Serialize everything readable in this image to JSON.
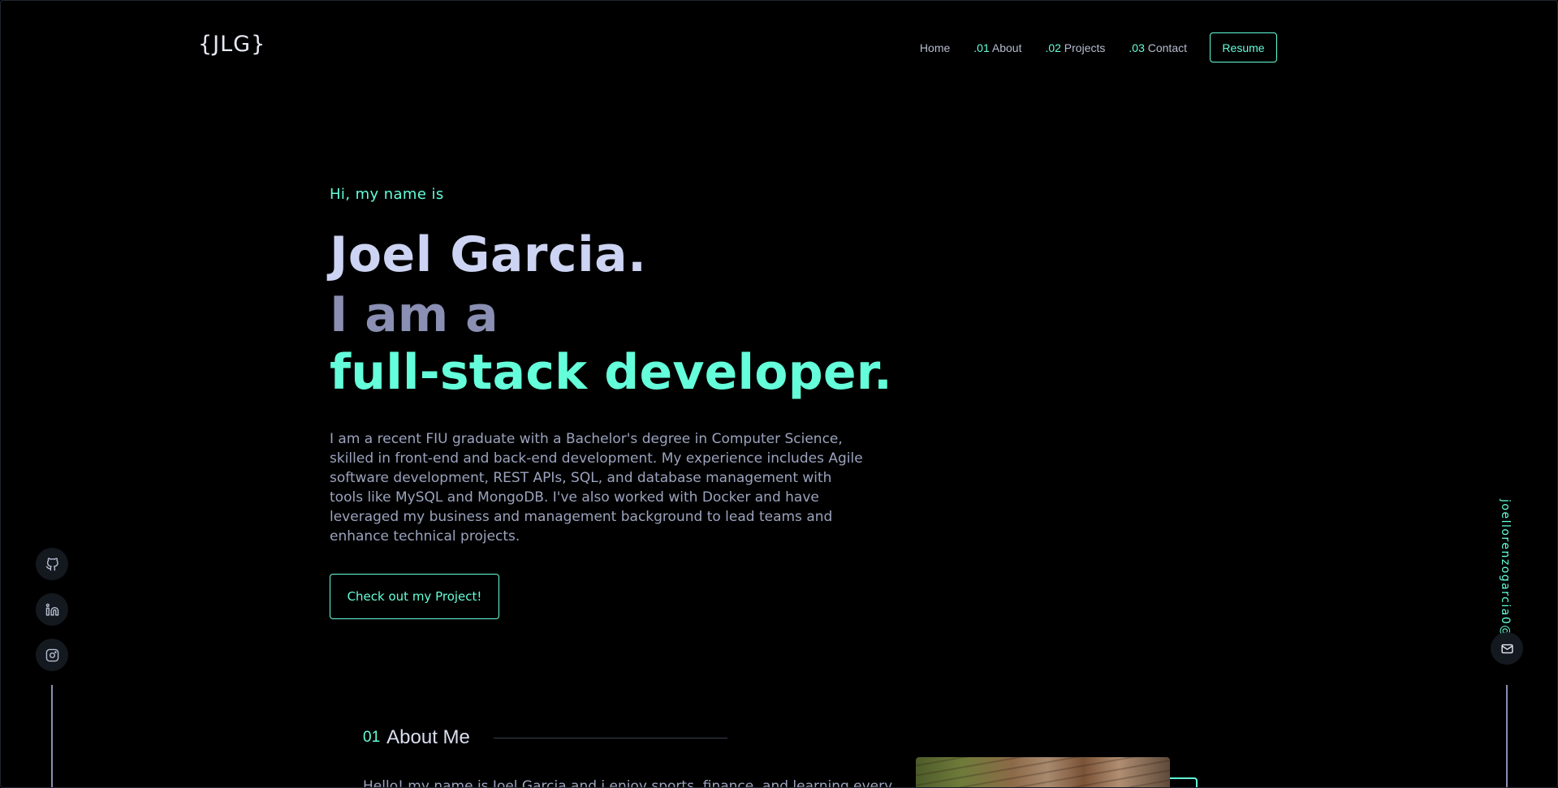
{
  "header": {
    "logo": "{JLG}",
    "nav": [
      {
        "num": "",
        "label": "Home"
      },
      {
        "num": ".01",
        "label": " About"
      },
      {
        "num": ".02",
        "label": " Projects"
      },
      {
        "num": ".03",
        "label": " Contact"
      }
    ],
    "resume_label": "Resume"
  },
  "hero": {
    "greeting": "Hi, my name is",
    "name": "Joel Garcia.",
    "tagline": "I am a",
    "role": "full-stack developer.",
    "bio": "I am a recent FIU graduate with a Bachelor's degree in Computer Science, skilled in front-end and back-end development. My experience includes Agile software development, REST APIs, SQL, and database management with tools like MySQL and MongoDB. I've also worked with Docker and have leveraged my business and management background to lead teams and enhance technical projects.",
    "cta_label": "Check out my Project!"
  },
  "social": {
    "icons": [
      "github-icon",
      "linkedin-icon",
      "instagram-icon"
    ]
  },
  "email": {
    "address": "joellorenzogarcia0@",
    "icon": "mail-icon"
  },
  "about": {
    "num": "01",
    "title": "About Me",
    "text": "Hello! my name is Joel Garcia and i enjoy sports, finance, and learning every"
  },
  "colors": {
    "accent": "#64ffda",
    "background": "#000000",
    "heading": "#cdd3f2",
    "muted": "#8a8fb3",
    "body_text": "#9ba3bd"
  }
}
